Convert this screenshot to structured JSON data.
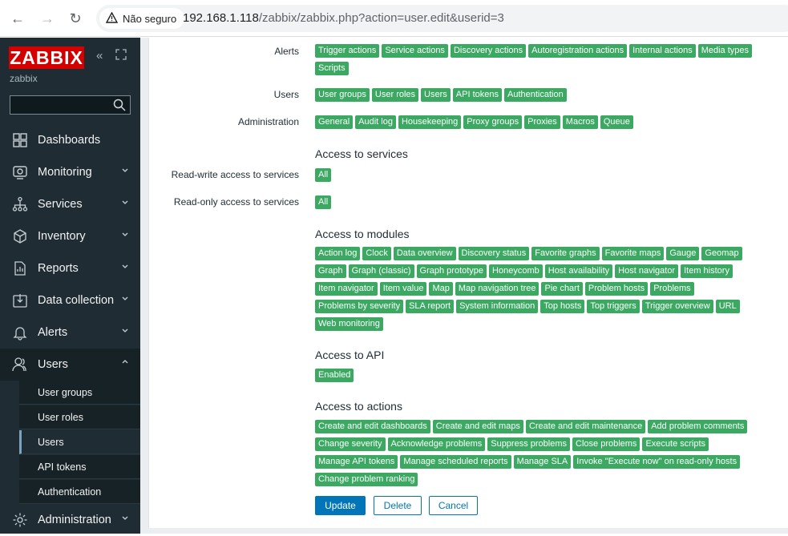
{
  "browser": {
    "security_label": "Não seguro",
    "url_host": "192.168.1.118",
    "url_path": "/zabbix/zabbix.php?action=user.edit&userid=3"
  },
  "sidebar": {
    "logo": "ZABBIX",
    "server_name": "zabbix",
    "search_placeholder": "",
    "menu": [
      {
        "label": "Dashboards",
        "icon": "dashboard-icon",
        "expandable": false
      },
      {
        "label": "Monitoring",
        "icon": "monitoring-icon",
        "expandable": true
      },
      {
        "label": "Services",
        "icon": "services-icon",
        "expandable": true
      },
      {
        "label": "Inventory",
        "icon": "inventory-icon",
        "expandable": true
      },
      {
        "label": "Reports",
        "icon": "reports-icon",
        "expandable": true
      },
      {
        "label": "Data collection",
        "icon": "data-collection-icon",
        "expandable": true
      },
      {
        "label": "Alerts",
        "icon": "bell-icon",
        "expandable": true
      },
      {
        "label": "Users",
        "icon": "users-icon",
        "expandable": true,
        "expanded": true
      },
      {
        "label": "Administration",
        "icon": "gear-icon",
        "expandable": true
      }
    ],
    "users_submenu": [
      "User groups",
      "User roles",
      "Users",
      "API tokens",
      "Authentication"
    ],
    "selected_submenu": "Users"
  },
  "form": {
    "alerts": {
      "label": "Alerts",
      "tags": [
        "Trigger actions",
        "Service actions",
        "Discovery actions",
        "Autoregistration actions",
        "Internal actions",
        "Media types",
        "Scripts"
      ]
    },
    "users": {
      "label": "Users",
      "tags": [
        "User groups",
        "User roles",
        "Users",
        "API tokens",
        "Authentication"
      ]
    },
    "administration": {
      "label": "Administration",
      "tags": [
        "General",
        "Audit log",
        "Housekeeping",
        "Proxy groups",
        "Proxies",
        "Macros",
        "Queue"
      ]
    },
    "services_heading": "Access to services",
    "rw_services": {
      "label": "Read-write access to services",
      "tags": [
        "All"
      ]
    },
    "ro_services": {
      "label": "Read-only access to services",
      "tags": [
        "All"
      ]
    },
    "modules_heading": "Access to modules",
    "modules": [
      "Action log",
      "Clock",
      "Data overview",
      "Discovery status",
      "Favorite graphs",
      "Favorite maps",
      "Gauge",
      "Geomap",
      "Graph",
      "Graph (classic)",
      "Graph prototype",
      "Honeycomb",
      "Host availability",
      "Host navigator",
      "Item history",
      "Item navigator",
      "Item value",
      "Map",
      "Map navigation tree",
      "Pie chart",
      "Problem hosts",
      "Problems",
      "Problems by severity",
      "SLA report",
      "System information",
      "Top hosts",
      "Top triggers",
      "Trigger overview",
      "URL",
      "Web monitoring"
    ],
    "api_heading": "Access to API",
    "api": [
      "Enabled"
    ],
    "actions_heading": "Access to actions",
    "actions": [
      "Create and edit dashboards",
      "Create and edit maps",
      "Create and edit maintenance",
      "Add problem comments",
      "Change severity",
      "Acknowledge problems",
      "Suppress problems",
      "Close problems",
      "Execute scripts",
      "Manage API tokens",
      "Manage scheduled reports",
      "Manage SLA",
      "Invoke \"Execute now\" on read-only hosts",
      "Change problem ranking"
    ],
    "buttons": {
      "update": "Update",
      "delete": "Delete",
      "cancel": "Cancel"
    }
  },
  "colors": {
    "tag_green": "#3ca963",
    "sidebar_bg": "#1f2c33",
    "primary_blue": "#0275b8",
    "logo_red": "#d40000"
  }
}
